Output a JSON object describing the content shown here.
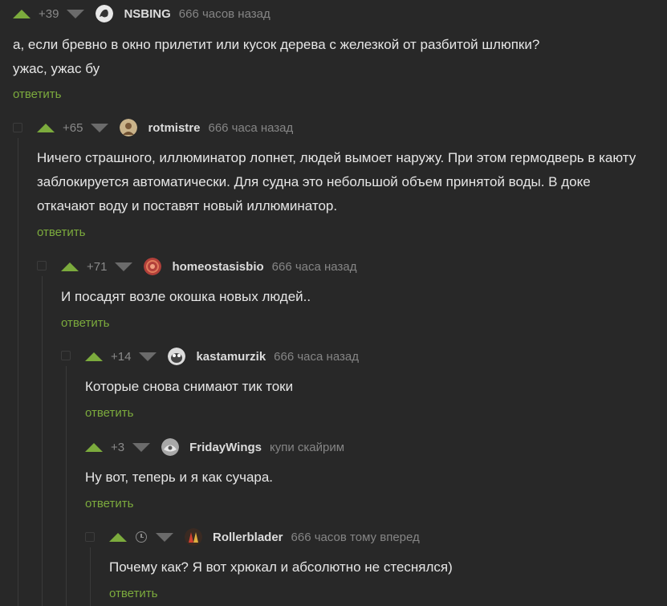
{
  "comments": [
    {
      "rating": "+39",
      "username": "NSBING",
      "meta": "666 часов назад",
      "avatar": "nsbing-avatar",
      "lines": [
        "а, если бревно в окно прилетит или кусок дерева с железкой от разбитой шлюпки?",
        "ужас, ужас бу"
      ],
      "reply": "ответить"
    },
    {
      "rating": "+65",
      "username": "rotmistre",
      "meta": "666 часа назад",
      "avatar": "rotmistre-avatar",
      "lines": [
        "Ничего страшного, иллюминатор лопнет, людей вымоет наружу. При этом гермодверь в каюту",
        "заблокируется автоматически. Для судна это небольшой объем принятой воды. В доке",
        "откачают воду и поставят новый иллюминатор."
      ],
      "reply": "ответить"
    },
    {
      "rating": "+71",
      "username": "homeostasisbio",
      "meta": "666 часа назад",
      "avatar": "homeostasisbio-avatar",
      "lines": [
        "И посадят возле окошка новых людей.."
      ],
      "reply": "ответить"
    },
    {
      "rating": "+14",
      "username": "kastamurzik",
      "meta": "666 часа назад",
      "avatar": "kastamurzik-avatar",
      "lines": [
        "Которые снова снимают тик токи"
      ],
      "reply": "ответить"
    },
    {
      "rating": "+3",
      "username": "FridayWings",
      "meta": "купи скайрим",
      "avatar": "fridaywings-avatar",
      "lines": [
        "Ну вот, теперь и я как сучара."
      ],
      "reply": "ответить"
    },
    {
      "rating": "",
      "username": "Rollerblader",
      "meta": "666 часов тому вперед",
      "avatar": "rollerblader-avatar",
      "lines": [
        "Почему как? Я вот хрюкал и абсолютно не стеснялся)"
      ],
      "reply": "ответить"
    }
  ],
  "colors": {
    "background": "#282828",
    "upvote": "#7cab3d",
    "downvote": "#6b6b6b",
    "reply_link": "#7cab3d"
  }
}
